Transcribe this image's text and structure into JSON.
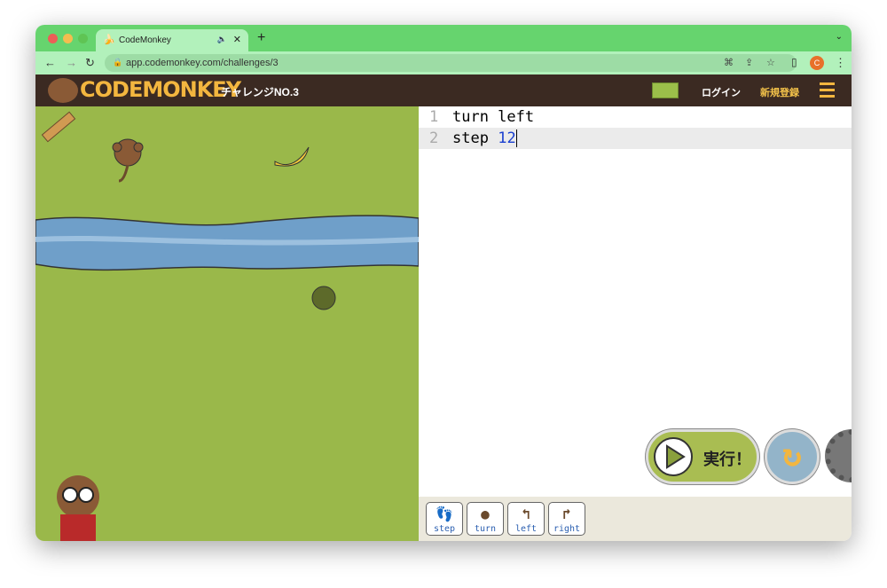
{
  "browser": {
    "tab_title": "CodeMonkey",
    "url": "app.codemonkey.com/challenges/3",
    "profile_initial": "C"
  },
  "app": {
    "logo": "CODEMONKEY",
    "challenge": "チャレンジNO.3",
    "login": "ログイン",
    "signup": "新規登録"
  },
  "editor": {
    "lines": [
      {
        "n": "1",
        "code": "turn left"
      },
      {
        "n": "2",
        "kw": "step",
        "num": "12"
      }
    ]
  },
  "controls": {
    "run": "実行！"
  },
  "palette": [
    "step",
    "turn",
    "left",
    "right"
  ],
  "colors": {
    "browser_green": "#66d46e",
    "header": "#3b2a22",
    "grass": "#9ab84a",
    "river": "#6f9fc9",
    "accent": "#f3b63f"
  }
}
